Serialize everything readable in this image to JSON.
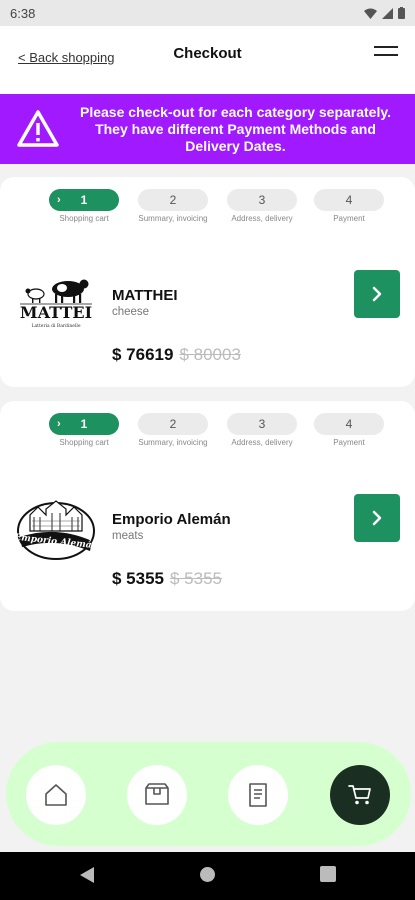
{
  "status_bar": {
    "time": "6:38"
  },
  "header": {
    "back_label": "< Back shopping",
    "title": "Checkout"
  },
  "banner": {
    "message": "Please check-out for each category separately. They have different Payment Methods and Delivery Dates."
  },
  "steps": [
    {
      "number": "1",
      "caption": "Shopping cart",
      "active": true
    },
    {
      "number": "2",
      "caption": "Summary, invoicing",
      "active": false
    },
    {
      "number": "3",
      "caption": "Address, delivery",
      "active": false
    },
    {
      "number": "4",
      "caption": "Payment",
      "active": false
    }
  ],
  "carts": [
    {
      "vendor": "MATTHEI",
      "category": "cheese",
      "price": "$ 76619",
      "old_price": "$ 80003",
      "logo_text": "MATTEI",
      "logo_subtext": "Latteria di Bardinelle"
    },
    {
      "vendor": "Emporio Alemán",
      "category": "meats",
      "price": "$ 5355",
      "old_price": "$ 5355",
      "logo_text": "Emporio Alemán"
    }
  ],
  "bottom_nav": [
    {
      "icon": "home-icon",
      "active": false
    },
    {
      "icon": "box-icon",
      "active": false
    },
    {
      "icon": "document-icon",
      "active": false
    },
    {
      "icon": "cart-icon",
      "active": true
    }
  ],
  "colors": {
    "accent_green": "#1e9160",
    "banner_purple": "#a019ff",
    "nav_bg": "#d6ffd0",
    "nav_active": "#1a2e22"
  }
}
